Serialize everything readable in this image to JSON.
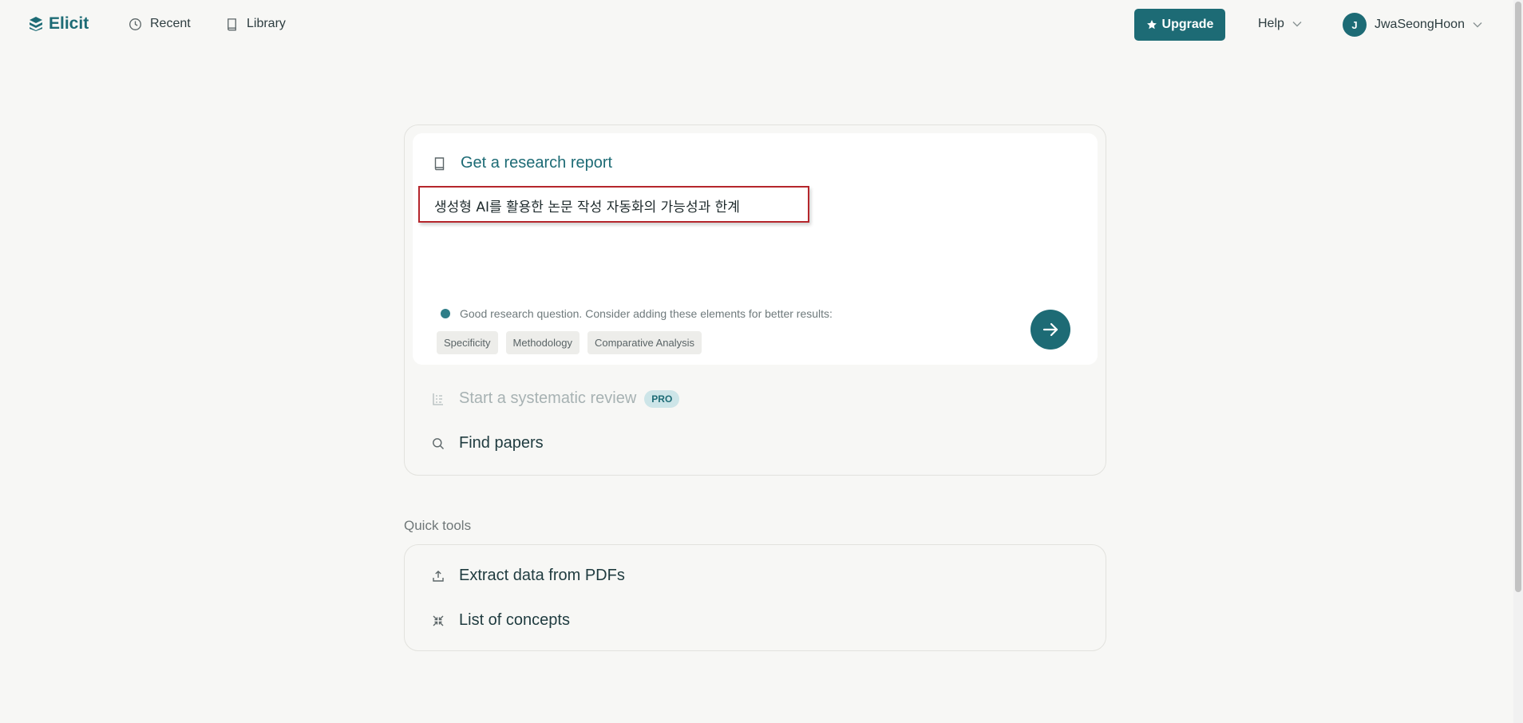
{
  "header": {
    "brand": "Elicit",
    "nav": [
      {
        "label": "Recent",
        "icon": "clock-icon"
      },
      {
        "label": "Library",
        "icon": "book-icon"
      }
    ],
    "upgrade_label": "Upgrade",
    "help_label": "Help",
    "user": {
      "initial": "J",
      "name": "JwaSeongHoon"
    }
  },
  "main": {
    "report_title": "Get a research report",
    "query": "생성형 AI를 활용한 논문 작성 자동화의 가능성과 한계",
    "hint": "Good research question. Consider adding these elements for better results:",
    "chips": [
      "Specificity",
      "Methodology",
      "Comparative Analysis"
    ],
    "systematic_review_label": "Start a systematic review",
    "pro_badge": "PRO",
    "find_papers_label": "Find papers"
  },
  "quick_tools": {
    "title": "Quick tools",
    "items": [
      {
        "label": "Extract data from PDFs",
        "icon": "upload-icon"
      },
      {
        "label": "List of concepts",
        "icon": "collapse-arrows-icon"
      }
    ]
  },
  "colors": {
    "accent": "#1d6b75",
    "background": "#f7f7f5",
    "highlight_border": "#b5262c"
  }
}
